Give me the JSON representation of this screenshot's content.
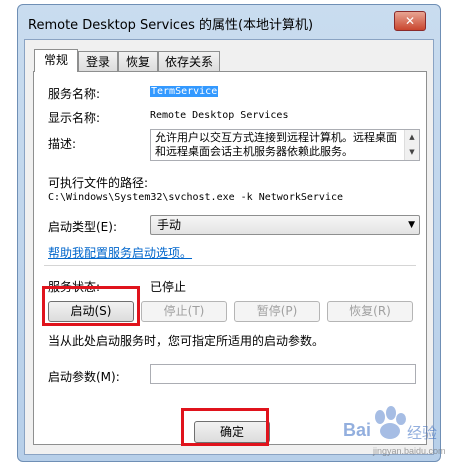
{
  "window": {
    "title": "Remote Desktop Services 的属性(本地计算机)",
    "close_symbol": "✕"
  },
  "tabs": [
    {
      "label": "常规"
    },
    {
      "label": "登录"
    },
    {
      "label": "恢复"
    },
    {
      "label": "依存关系"
    }
  ],
  "general": {
    "service_name_label": "服务名称:",
    "service_name_value": "TermService",
    "display_name_label": "显示名称:",
    "display_name_value": "Remote Desktop Services",
    "description_label": "描述:",
    "description_value": "允许用户以交互方式连接到远程计算机。远程桌面和远程桌面会话主机服务器依赖此服务。",
    "path_label": "可执行文件的路径:",
    "path_value": "C:\\Windows\\System32\\svchost.exe -k NetworkService",
    "startup_type_label": "启动类型(E):",
    "startup_type_value": "手动",
    "help_link": "帮助我配置服务启动选项。",
    "service_status_label": "服务状态:",
    "service_status_value": "已停止",
    "start_button": "启动(S)",
    "stop_button": "停止(T)",
    "pause_button": "暂停(P)",
    "resume_button": "恢复(R)",
    "hint_text": "当从此处启动服务时，您可指定所适用的启动参数。",
    "start_params_label": "启动参数(M):",
    "start_params_value": ""
  },
  "footer": {
    "ok_button": "确定"
  },
  "watermark": {
    "brand_text": "Bai",
    "logo_word": "经验",
    "url": "jingyan.baidu.com"
  },
  "colors": {
    "highlight": "#e0131c",
    "selection": "#3399ff",
    "link": "#0066cc"
  }
}
